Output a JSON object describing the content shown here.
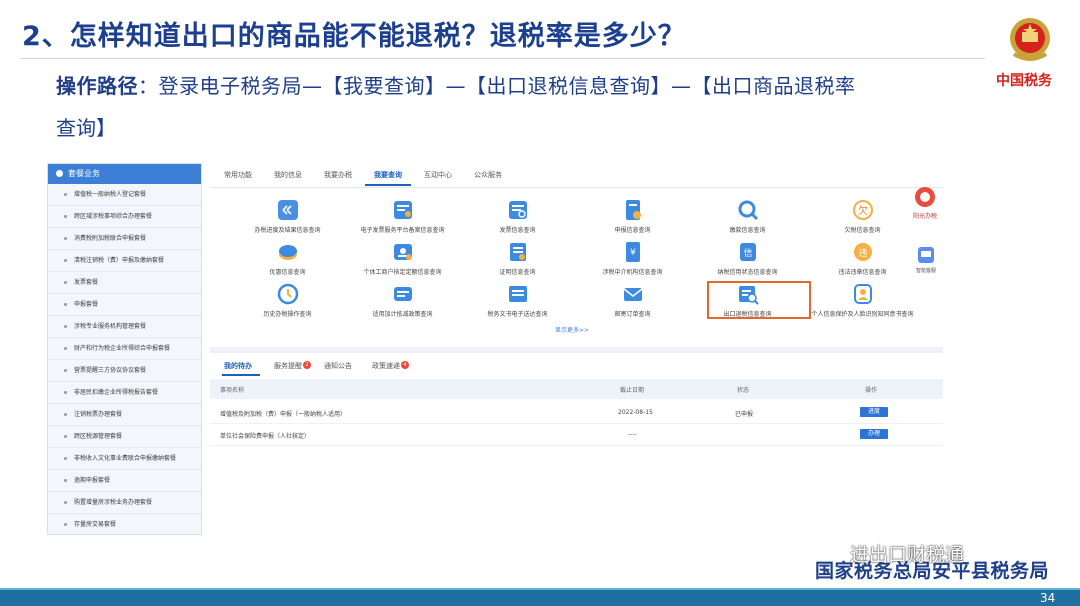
{
  "slide": {
    "title": "2、怎样知道出口的商品能不能退税？退税率是多少？",
    "path_label": "操作路径",
    "path_colon": "：",
    "path_text_line1": "登录电子税务局—【我要查询】—【出口退税信息查询】—【出口商品退税率",
    "path_text_line2": "查询】",
    "brand_text": "中国税务",
    "footer_text": "国家税务总局安平县税务局",
    "watermark_text": "进出口财税通",
    "page_number": "34"
  },
  "sidebar": {
    "header": "套餐业务",
    "items": [
      "增值税一般纳税人登记套餐",
      "跨区域涉税事项综合办理套餐",
      "消费税附加税联合申报套餐",
      "清税注销税（费）申报及缴纳套餐",
      "发票套餐",
      "申报套餐",
      "涉税专业服务机构管理套餐",
      "财产和行为税企业所得综合申报套餐",
      "营票提醒三方协议协议套餐",
      "非居民扣缴企业所得税报告套餐",
      "注销税票办理套餐",
      "跨区税源管理套餐",
      "非税收入文化事业费联合申报缴纳套餐",
      "逾期申报套餐",
      "购置增量房涉税业务办理套餐",
      "存量房交易套餐"
    ]
  },
  "tabs": [
    {
      "label": "常用功能"
    },
    {
      "label": "我的信息"
    },
    {
      "label": "我要办税"
    },
    {
      "label": "我要查询"
    },
    {
      "label": "互动中心"
    },
    {
      "label": "公众服务"
    }
  ],
  "services": [
    {
      "label": "办税进度及结果信息查询",
      "icon": "progress-icon"
    },
    {
      "label": "电子发票服务平台备案信息查询",
      "icon": "invoice-platform-icon"
    },
    {
      "label": "发票信息查询",
      "icon": "invoice-icon"
    },
    {
      "label": "申报信息查询",
      "icon": "declaration-icon"
    },
    {
      "label": "缴款信息查询",
      "icon": "payment-search-icon"
    },
    {
      "label": "欠税信息查询",
      "icon": "arrears-icon"
    },
    {
      "label": "优惠信息查询",
      "icon": "discount-icon"
    },
    {
      "label": "个体工商户核定定额信息查询",
      "icon": "quota-icon"
    },
    {
      "label": "证明信息查询",
      "icon": "certificate-icon"
    },
    {
      "label": "涉税中介机构信息查询",
      "icon": "agency-icon"
    },
    {
      "label": "纳税信用状态信息查询",
      "icon": "credit-icon"
    },
    {
      "label": "违法违章信息查询",
      "icon": "violation-icon"
    },
    {
      "label": "历史办税操作查询",
      "icon": "history-icon"
    },
    {
      "label": "适用加计抵减政策查询",
      "icon": "policy-icon"
    },
    {
      "label": "税务文书电子送达查询",
      "icon": "document-icon"
    },
    {
      "label": "邮寄订单查询",
      "icon": "mail-icon"
    },
    {
      "label": "出口退税信息查询",
      "icon": "export-refund-icon"
    },
    {
      "label": "个人信息保护及人脸识别知同意书查询",
      "icon": "privacy-icon"
    }
  ],
  "more_link": "显示更多>>",
  "side_widgets": {
    "widget1_label": "阳光办税",
    "widget2_label": "智能客服"
  },
  "todo": {
    "tabs": [
      {
        "label": "我的待办",
        "badge": ""
      },
      {
        "label": "服务提醒",
        "badge": "2"
      },
      {
        "label": "通知公告",
        "badge": ""
      },
      {
        "label": "政策速递",
        "badge": "4"
      }
    ],
    "headers": [
      "事项名称",
      "截止日期",
      "状态",
      "操作"
    ],
    "rows": [
      {
        "name": "增值税及附加税（费）申报（一般纳税人适用）",
        "deadline": "2022-08-15",
        "status": "已申报",
        "action": "进度"
      },
      {
        "name": "单位社会保险费申报（人社核定）",
        "deadline": "----",
        "status": "",
        "action": "办理"
      }
    ]
  },
  "colors": {
    "title": "#1d3f8f",
    "accent": "#3d7fd6",
    "highlight": "#e0692b",
    "brand": "#d3231c",
    "bottom_bar": "#1f6fa0"
  }
}
